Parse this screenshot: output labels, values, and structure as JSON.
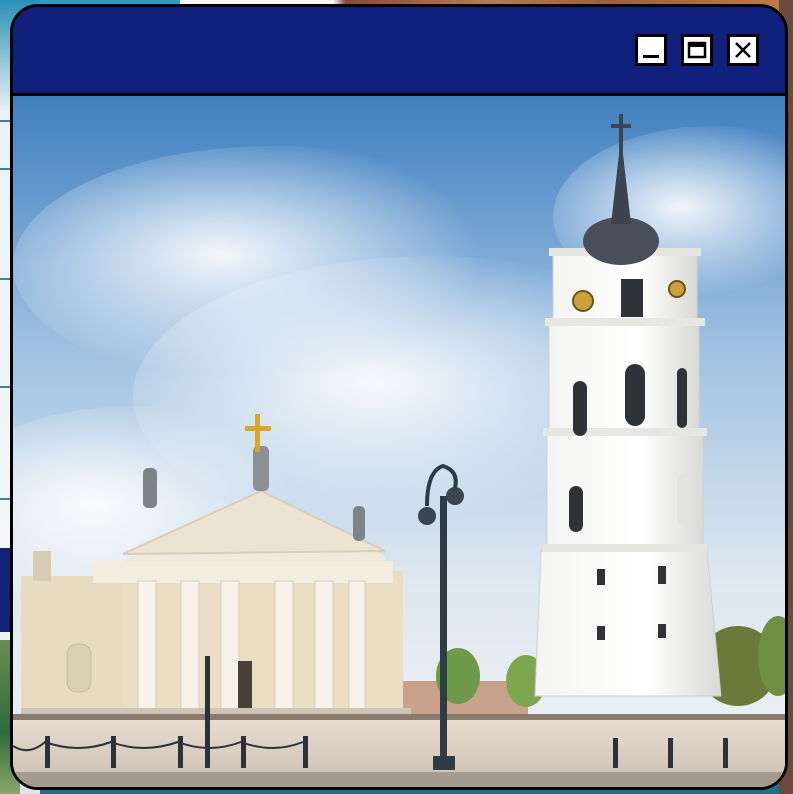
{
  "window": {
    "controls": {
      "minimize_icon": "minimize-icon",
      "maximize_icon": "maximize-icon",
      "close_icon": "close-icon"
    }
  },
  "photo": {
    "subject_icon": "cathedral-and-bell-tower-photo"
  },
  "colors": {
    "titlebar": "#12207d",
    "border": "#000000",
    "control_bg": "#ffffff"
  }
}
